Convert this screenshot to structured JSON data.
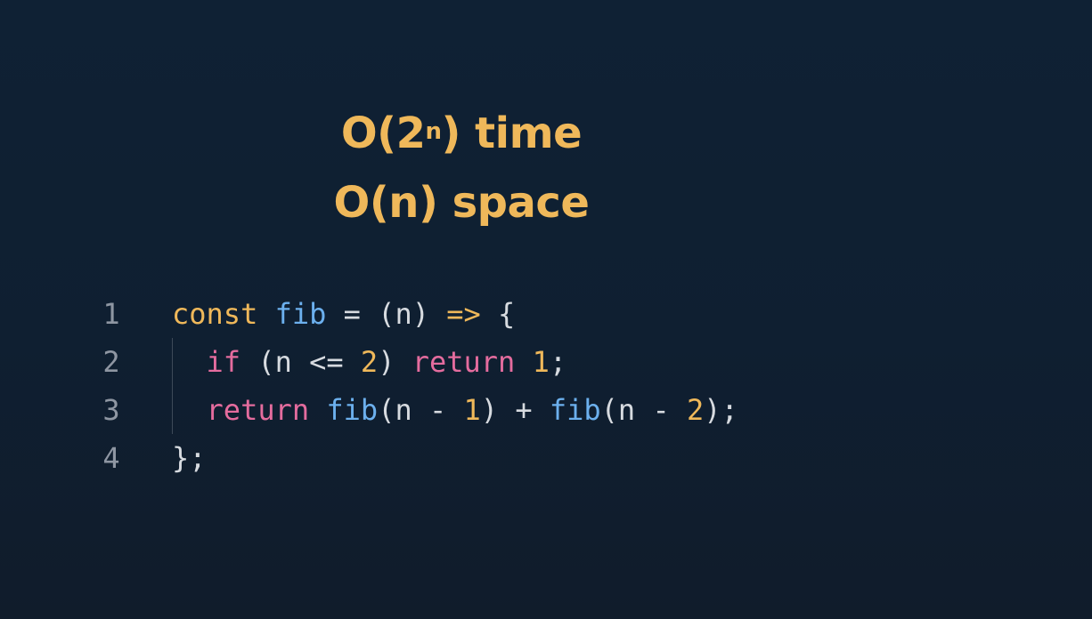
{
  "complexity": {
    "time_prefix": "O(2",
    "time_exp": "n",
    "time_suffix": ") time",
    "space": "O(n) space"
  },
  "code": {
    "lines": [
      {
        "number": "1",
        "tokens": [
          {
            "text": "const",
            "kind": "kw"
          },
          {
            "text": " ",
            "kind": "op"
          },
          {
            "text": "fib",
            "kind": "fn"
          },
          {
            "text": " = (",
            "kind": "op"
          },
          {
            "text": "n",
            "kind": "op"
          },
          {
            "text": ") ",
            "kind": "op"
          },
          {
            "text": "=>",
            "kind": "kw"
          },
          {
            "text": " {",
            "kind": "op"
          }
        ]
      },
      {
        "number": "2",
        "tokens": [
          {
            "text": "  ",
            "kind": "op"
          },
          {
            "text": "if",
            "kind": "pk"
          },
          {
            "text": " (n <= ",
            "kind": "op"
          },
          {
            "text": "2",
            "kind": "nm"
          },
          {
            "text": ") ",
            "kind": "op"
          },
          {
            "text": "return",
            "kind": "pk"
          },
          {
            "text": " ",
            "kind": "op"
          },
          {
            "text": "1",
            "kind": "nm"
          },
          {
            "text": ";",
            "kind": "op"
          }
        ]
      },
      {
        "number": "3",
        "tokens": [
          {
            "text": "  ",
            "kind": "op"
          },
          {
            "text": "return",
            "kind": "pk"
          },
          {
            "text": " ",
            "kind": "op"
          },
          {
            "text": "fib",
            "kind": "fn"
          },
          {
            "text": "(n - ",
            "kind": "op"
          },
          {
            "text": "1",
            "kind": "nm"
          },
          {
            "text": ") + ",
            "kind": "op"
          },
          {
            "text": "fib",
            "kind": "fn"
          },
          {
            "text": "(n - ",
            "kind": "op"
          },
          {
            "text": "2",
            "kind": "nm"
          },
          {
            "text": ");",
            "kind": "op"
          }
        ]
      },
      {
        "number": "4",
        "tokens": [
          {
            "text": "};",
            "kind": "op"
          }
        ]
      }
    ]
  },
  "colors": {
    "background": "#0f2134",
    "heading": "#efb85a",
    "keyword_const": "#efb85a",
    "function_name": "#6cb0ee",
    "control_keyword": "#e46c9e",
    "number_literal": "#efb85a",
    "punctuation": "#d7dbe0",
    "line_number": "#8e96a2"
  }
}
